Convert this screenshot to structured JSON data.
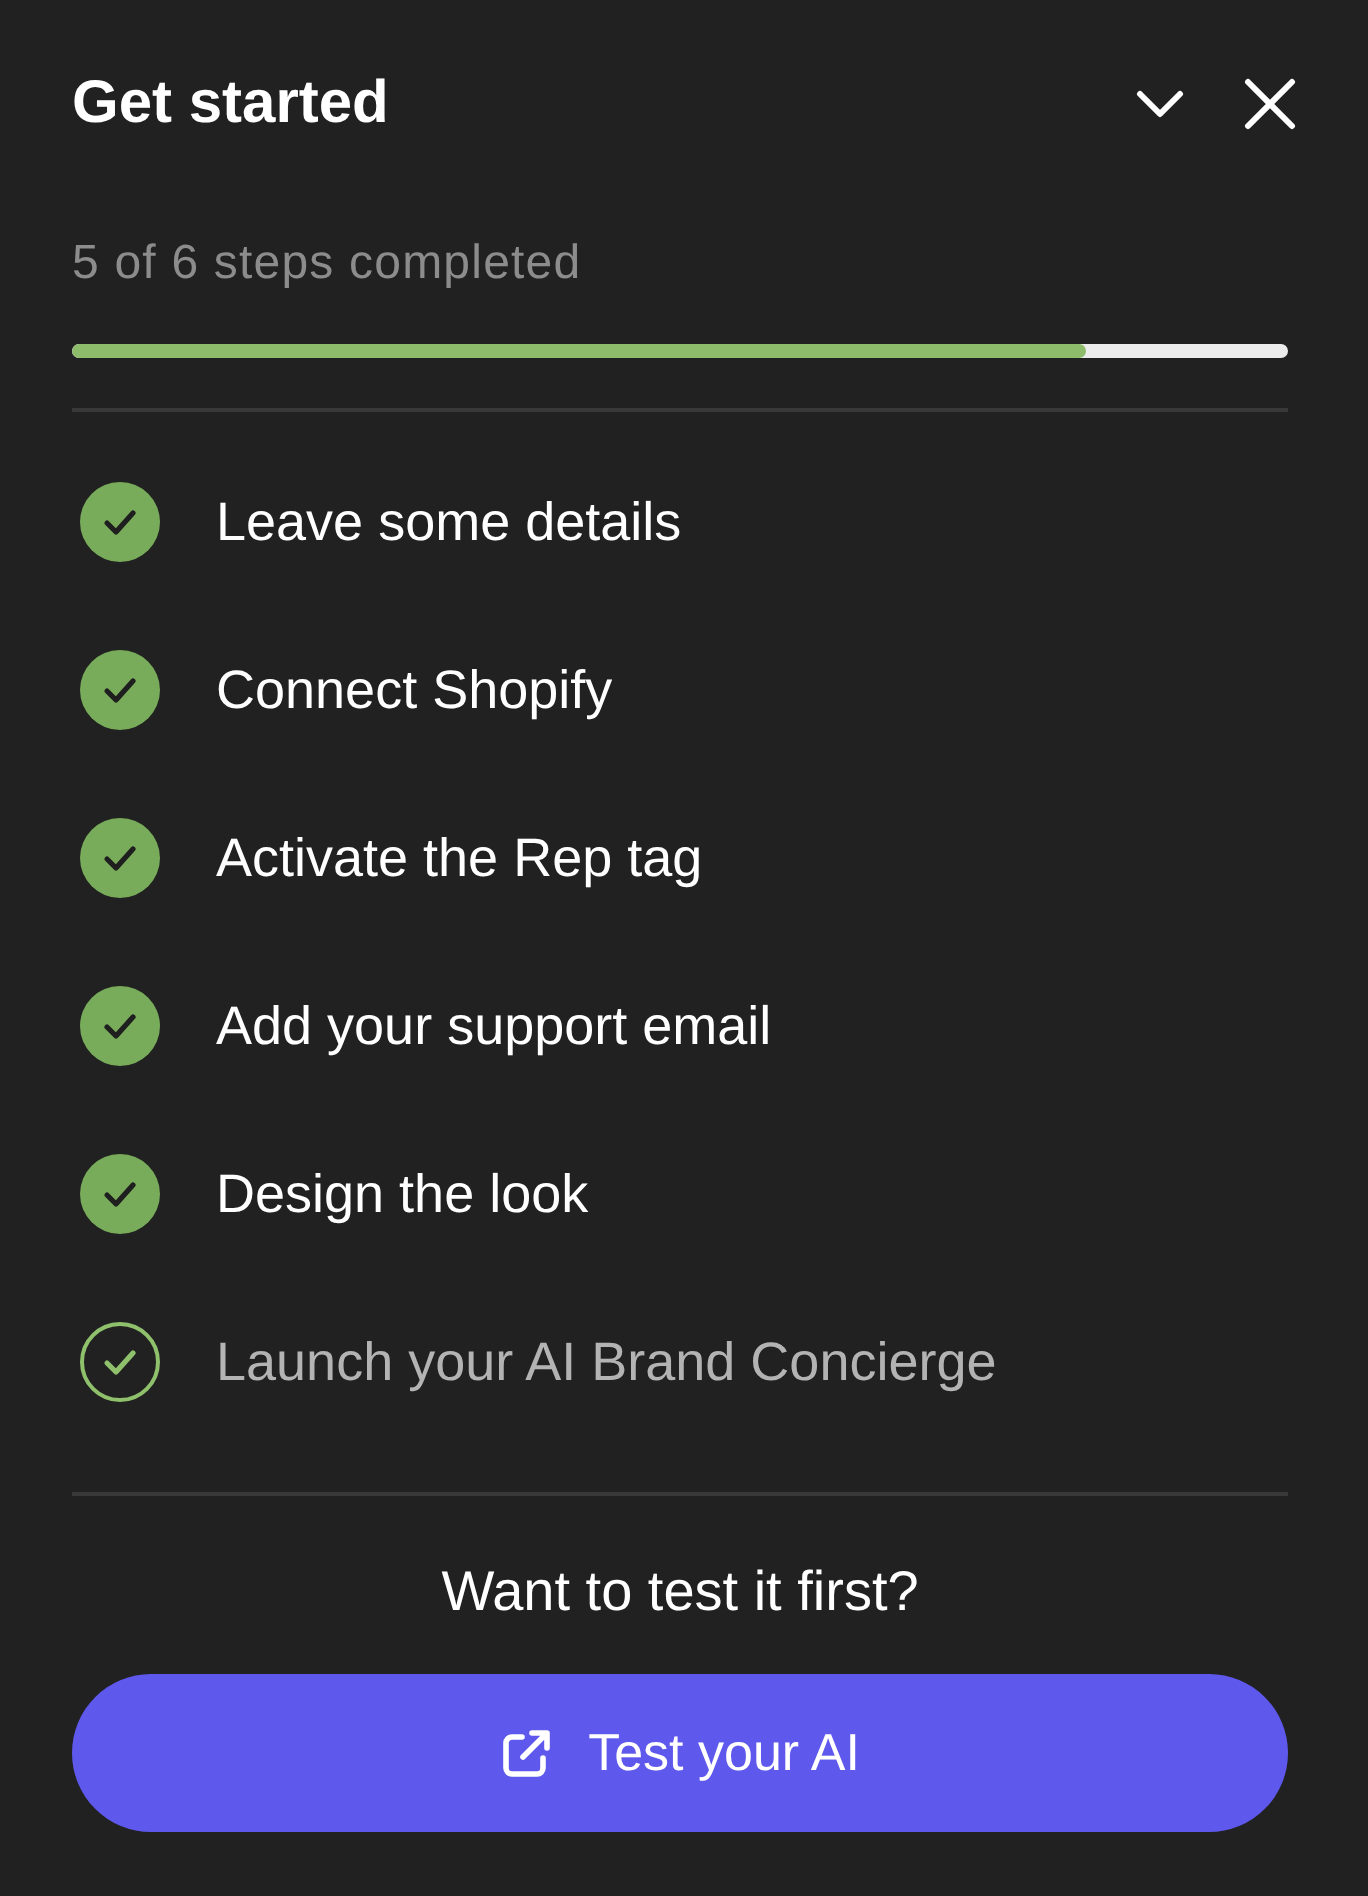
{
  "header": {
    "title": "Get started"
  },
  "progress": {
    "label": "5 of 6 steps completed",
    "level": 0.834
  },
  "steps": [
    {
      "label": "Leave some details",
      "completed": true
    },
    {
      "label": "Connect Shopify",
      "completed": true
    },
    {
      "label": "Activate the Rep tag",
      "completed": true
    },
    {
      "label": "Add your support email",
      "completed": true
    },
    {
      "label": "Design the look",
      "completed": true
    },
    {
      "label": "Launch your AI Brand Concierge",
      "completed": false
    }
  ],
  "test_prompt": {
    "question": "Want to test it first?",
    "button": "Test your AI"
  }
}
